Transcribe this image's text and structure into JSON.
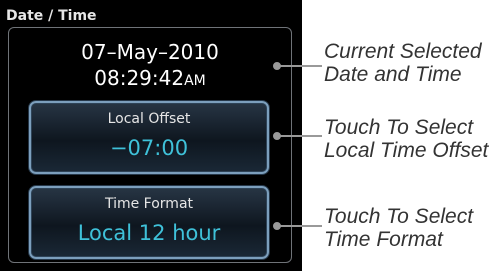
{
  "header": {
    "title": "Date / Time"
  },
  "datetime": {
    "date": "07–May–2010",
    "time": "08:29:42",
    "ampm": "AM"
  },
  "buttons": {
    "local_offset": {
      "label": "Local Offset",
      "value": "−07:00"
    },
    "time_format": {
      "label": "Time Format",
      "value": "Local 12 hour"
    }
  },
  "callouts": {
    "current": {
      "line1": "Current Selected",
      "line2": "Date and Time"
    },
    "offset": {
      "line1": "Touch To Select",
      "line2": "Local Time Offset"
    },
    "format": {
      "line1": "Touch To Select",
      "line2": "Time Format"
    }
  },
  "colors": {
    "background": "#000000",
    "value_text": "#3fc1d9",
    "button_border": "#7c9fbd",
    "callout_line": "#999999"
  }
}
